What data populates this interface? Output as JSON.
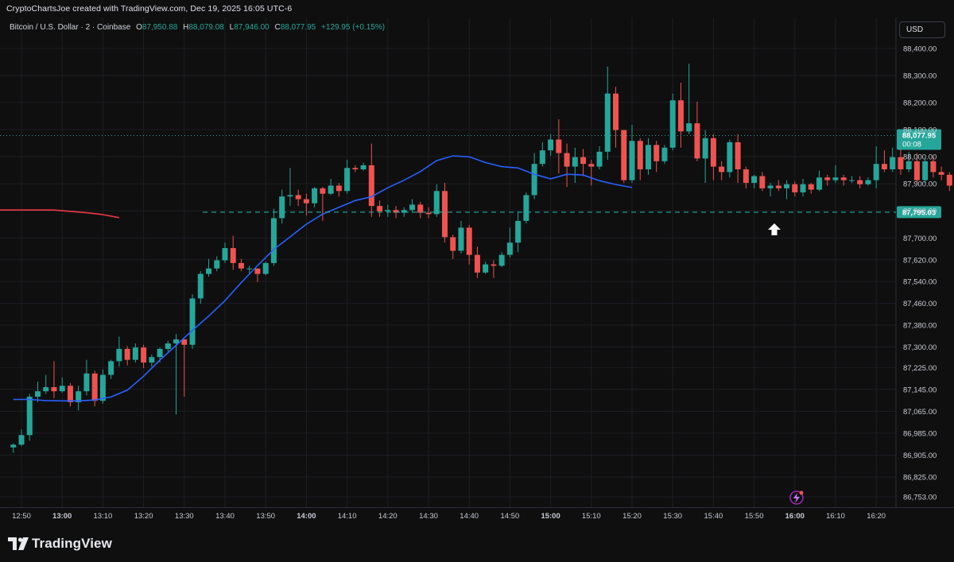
{
  "attribution": "CryptoChartsJoe created with TradingView.com, Dec 19, 2025 16:05 UTC-6",
  "legend": {
    "symbol": "Bitcoin / U.S. Dollar · 2 · Coinbase",
    "o_label": "O",
    "o_value": "87,950.88",
    "h_label": "H",
    "h_value": "88,079.08",
    "l_label": "L",
    "l_value": "87,946.00",
    "c_label": "C",
    "c_value": "88,077.95",
    "change": "+129.95 (+0.15%)"
  },
  "currency_button": "USD",
  "last_price_label": "88,077.95",
  "countdown_label": "00:08",
  "horizontal_level_label": "87,795.03",
  "brand": "TradingView",
  "colors": {
    "up": "#26a69a",
    "down": "#ef5350",
    "ema_fast": "#2962ff",
    "ema_slow": "#f23645",
    "grid": "#1c1e24",
    "background": "#0f0f0f",
    "level": "#26a69a"
  },
  "icons": [
    "tradingview-logo-icon",
    "arrow-up-icon",
    "lightning-icon"
  ],
  "chart_data": {
    "type": "candlestick",
    "title": "Bitcoin / U.S. Dollar · 2 · Coinbase",
    "interval_minutes": 2,
    "y_axis_labels": [
      "88,400.00",
      "88,300.00",
      "88,200.00",
      "88,100.00",
      "88,000.00",
      "87,900.00",
      "87,800.00",
      "87,700.00",
      "87,620.00",
      "87,540.00",
      "87,460.00",
      "87,380.00",
      "87,300.00",
      "87,225.00",
      "87,145.00",
      "87,065.00",
      "86,985.00",
      "86,905.00",
      "86,825.00",
      "86,753.00"
    ],
    "x_axis_labels": [
      "12:50",
      "13:00",
      "13:10",
      "13:20",
      "13:30",
      "13:40",
      "13:50",
      "14:00",
      "14:10",
      "14:20",
      "14:30",
      "14:40",
      "14:50",
      "15:00",
      "15:10",
      "15:20",
      "15:30",
      "15:40",
      "15:50",
      "16:00",
      "16:10",
      "16:20"
    ],
    "ylim": [
      86725,
      88470
    ],
    "scale": "log",
    "grid": true,
    "start_time": "12:48",
    "candles": [
      [
        86933,
        86943,
        86913,
        86948
      ],
      [
        86943,
        86978,
        86938,
        86998
      ],
      [
        86978,
        87118,
        86958,
        87128
      ],
      [
        87118,
        87138,
        87098,
        87173
      ],
      [
        87138,
        87153,
        87128,
        87198
      ],
      [
        87153,
        87138,
        87113,
        87248
      ],
      [
        87138,
        87158,
        87133,
        87188
      ],
      [
        87158,
        87098,
        87083,
        87168
      ],
      [
        87098,
        87138,
        87068,
        87158
      ],
      [
        87138,
        87203,
        87123,
        87253
      ],
      [
        87203,
        87103,
        87083,
        87213
      ],
      [
        87103,
        87198,
        87093,
        87218
      ],
      [
        87198,
        87248,
        87183,
        87253
      ],
      [
        87248,
        87293,
        87228,
        87338
      ],
      [
        87293,
        87253,
        87233,
        87303
      ],
      [
        87253,
        87298,
        87243,
        87313
      ],
      [
        87298,
        87243,
        87223,
        87308
      ],
      [
        87243,
        87263,
        87228,
        87273
      ],
      [
        87263,
        87293,
        87243,
        87298
      ],
      [
        87293,
        87313,
        87283,
        87323
      ],
      [
        87313,
        87328,
        87053,
        87348
      ],
      [
        87328,
        87308,
        87118,
        87328
      ],
      [
        87308,
        87478,
        87293,
        87493
      ],
      [
        87478,
        87568,
        87458,
        87578
      ],
      [
        87568,
        87588,
        87558,
        87623
      ],
      [
        87588,
        87618,
        87578,
        87633
      ],
      [
        87618,
        87663,
        87608,
        87683
      ],
      [
        87663,
        87608,
        87583,
        87708
      ],
      [
        87608,
        87588,
        87578,
        87623
      ],
      [
        87588,
        87588,
        87568,
        87598
      ],
      [
        87588,
        87568,
        87538,
        87588
      ],
      [
        87568,
        87608,
        87563,
        87613
      ],
      [
        87608,
        87773,
        87598,
        87808
      ],
      [
        87773,
        87853,
        87753,
        87878
      ],
      [
        87853,
        87858,
        87818,
        87958
      ],
      [
        87858,
        87843,
        87818,
        87878
      ],
      [
        87843,
        87828,
        87783,
        87863
      ],
      [
        87828,
        87883,
        87813,
        87888
      ],
      [
        87883,
        87863,
        87763,
        87888
      ],
      [
        87863,
        87893,
        87858,
        87918
      ],
      [
        87893,
        87873,
        87853,
        87903
      ],
      [
        87873,
        87958,
        87863,
        87988
      ],
      [
        87958,
        87953,
        87943,
        87968
      ],
      [
        87953,
        87968,
        87948,
        87978
      ],
      [
        87968,
        87818,
        87778,
        88048
      ],
      [
        87818,
        87798,
        87778,
        87838
      ],
      [
        87798,
        87803,
        87778,
        87823
      ],
      [
        87803,
        87793,
        87773,
        87818
      ],
      [
        87793,
        87803,
        87778,
        87813
      ],
      [
        87803,
        87823,
        87793,
        87843
      ],
      [
        87823,
        87793,
        87773,
        87833
      ],
      [
        87793,
        87788,
        87773,
        87813
      ],
      [
        87788,
        87873,
        87778,
        87898
      ],
      [
        87873,
        87703,
        87683,
        87903
      ],
      [
        87703,
        87653,
        87623,
        87713
      ],
      [
        87653,
        87738,
        87643,
        87763
      ],
      [
        87738,
        87638,
        87603,
        87748
      ],
      [
        87638,
        87573,
        87553,
        87668
      ],
      [
        87573,
        87603,
        87568,
        87613
      ],
      [
        87603,
        87598,
        87553,
        87618
      ],
      [
        87598,
        87638,
        87593,
        87648
      ],
      [
        87638,
        87683,
        87628,
        87738
      ],
      [
        87683,
        87763,
        87648,
        87798
      ],
      [
        87763,
        87858,
        87753,
        87868
      ],
      [
        87858,
        87973,
        87843,
        88013
      ],
      [
        87973,
        88023,
        87963,
        88053
      ],
      [
        88023,
        88063,
        88003,
        88083
      ],
      [
        88063,
        88013,
        87938,
        88138
      ],
      [
        88013,
        87963,
        87888,
        88048
      ],
      [
        87963,
        87998,
        87903,
        88033
      ],
      [
        87998,
        87973,
        87928,
        88028
      ],
      [
        87973,
        87963,
        87893,
        87988
      ],
      [
        87963,
        88018,
        87953,
        88038
      ],
      [
        88018,
        88233,
        87988,
        88333
      ],
      [
        88233,
        88098,
        88033,
        88258
      ],
      [
        88098,
        87913,
        87903,
        88098
      ],
      [
        87913,
        88058,
        87903,
        88118
      ],
      [
        88058,
        87953,
        87913,
        88068
      ],
      [
        87953,
        88043,
        87933,
        88068
      ],
      [
        88043,
        87983,
        87943,
        88058
      ],
      [
        87983,
        88033,
        87973,
        88043
      ],
      [
        88033,
        88208,
        88023,
        88233
      ],
      [
        88208,
        88093,
        88033,
        88273
      ],
      [
        88093,
        88123,
        88083,
        88343
      ],
      [
        88123,
        87993,
        87983,
        88203
      ],
      [
        87993,
        88068,
        87903,
        88098
      ],
      [
        88068,
        87963,
        87913,
        88083
      ],
      [
        87963,
        87943,
        87913,
        87983
      ],
      [
        87943,
        88053,
        87923,
        88063
      ],
      [
        88053,
        87953,
        87903,
        88083
      ],
      [
        87953,
        87903,
        87883,
        87963
      ],
      [
        87903,
        87928,
        87883,
        87933
      ],
      [
        87928,
        87883,
        87873,
        87943
      ],
      [
        87883,
        87893,
        87853,
        87903
      ],
      [
        87893,
        87883,
        87873,
        87913
      ],
      [
        87883,
        87898,
        87843,
        87913
      ],
      [
        87898,
        87868,
        87853,
        87908
      ],
      [
        87868,
        87898,
        87853,
        87918
      ],
      [
        87898,
        87878,
        87863,
        87903
      ],
      [
        87878,
        87923,
        87873,
        87948
      ],
      [
        87923,
        87913,
        87893,
        87933
      ],
      [
        87913,
        87923,
        87903,
        87968
      ],
      [
        87923,
        87913,
        87893,
        87933
      ],
      [
        87913,
        87913,
        87903,
        87928
      ],
      [
        87913,
        87898,
        87883,
        87928
      ],
      [
        87898,
        87913,
        87893,
        87923
      ],
      [
        87913,
        87973,
        87883,
        88038
      ],
      [
        87973,
        87953,
        87943,
        88023
      ],
      [
        87953,
        87998,
        87943,
        88033
      ],
      [
        87998,
        87953,
        87933,
        88028
      ],
      [
        87953,
        87983,
        87943,
        88018
      ],
      [
        87983,
        87913,
        87903,
        88013
      ],
      [
        87913,
        87983,
        87903,
        87993
      ],
      [
        87983,
        87943,
        87923,
        88003
      ],
      [
        87943,
        87933,
        87913,
        87963
      ],
      [
        87933,
        87893,
        87873,
        87943
      ],
      [
        87893,
        87873,
        87863,
        87903
      ],
      [
        87873,
        87868,
        87853,
        87883
      ],
      [
        87868,
        87888,
        87853,
        87903
      ],
      [
        87888,
        87868,
        87843,
        87893
      ],
      [
        87868,
        87853,
        87833,
        87878
      ],
      [
        87853,
        87833,
        87813,
        87863
      ],
      [
        87833,
        87823,
        87803,
        87853
      ],
      [
        87823,
        87808,
        87788,
        87833
      ],
      [
        87808,
        87773,
        87763,
        87813
      ],
      [
        87773,
        87763,
        87748,
        87783
      ],
      [
        87763,
        87788,
        87753,
        87798
      ],
      [
        87788,
        87853,
        87783,
        87868
      ],
      [
        87853,
        87938,
        87848,
        87953
      ],
      [
        87950.88,
        88077.95,
        87946,
        88079.08
      ]
    ],
    "ema_fast": [
      87108,
      87108,
      87104,
      87103,
      87103,
      87106,
      87117,
      87142,
      87193,
      87252,
      87306,
      87361,
      87413,
      87470,
      87536,
      87599,
      87658,
      87704,
      87751,
      87788,
      87813,
      87838,
      87852,
      87885,
      87913,
      87945,
      87985,
      88003,
      87999,
      87978,
      87963,
      87958,
      87935,
      87918,
      87935,
      87932,
      87911,
      87897,
      87886
    ],
    "ema_slow": [
      87888,
      87858,
      87838,
      87823,
      87813,
      87805,
      87800,
      87799,
      87800,
      87801,
      87803,
      87803,
      87803,
      87803,
      87803,
      87803,
      87798,
      87793,
      87786,
      87775
    ]
  }
}
